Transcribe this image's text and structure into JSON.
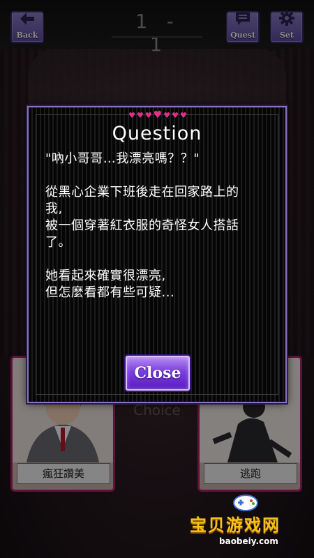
{
  "topbar": {
    "back_label": "Back",
    "stage": "1 - 1",
    "quest_label": "Quest",
    "set_label": "Set"
  },
  "choice": {
    "title": "Choice",
    "left_label": "瘋狂讚美",
    "right_label": "逃跑"
  },
  "modal": {
    "title": "Question",
    "paragraphs": [
      "\"吶小哥哥…我漂亮嗎？？\"",
      "從黑心企業下班後走在回家路上的\n我,\n被一個穿著紅衣服的奇怪女人搭話\n了。",
      "她看起來確實很漂亮,\n但怎麼看都有些可疑..."
    ],
    "close_label": "Close"
  },
  "watermark": {
    "text": "宝贝游戏网",
    "url": "baobeiy.com"
  },
  "colors": {
    "accent_purple": "#7b3ee0",
    "heart_pink": "#e0308a",
    "card_border": "#b0226a",
    "watermark_gold": "#f5c21b"
  },
  "icons": {
    "back": "back-arrow-icon",
    "quest": "quest-message-icon",
    "set": "settings-gear-icon"
  }
}
